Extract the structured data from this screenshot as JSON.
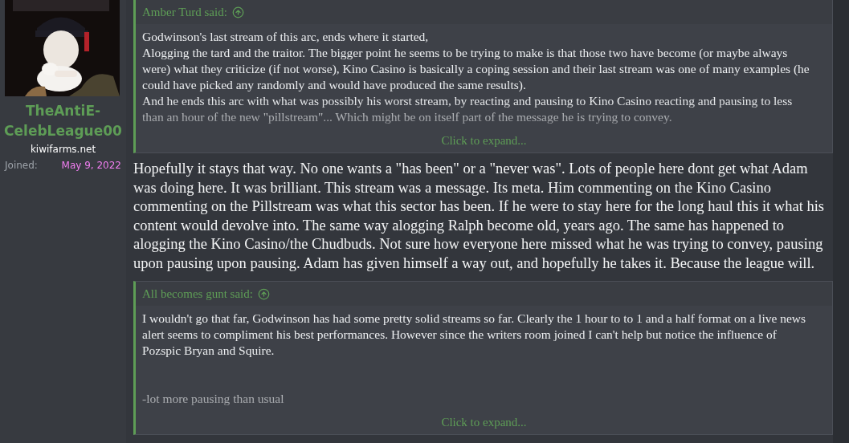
{
  "user": {
    "name": "TheAntiE-CelebLeague00",
    "title": "kiwifarms.net",
    "joined_label": "Joined:",
    "joined_date": "May 9, 2022"
  },
  "post": {
    "blocks": [
      {
        "kind": "quote",
        "author": "Amber Turd said:",
        "paragraphs": [
          "Godwinson's last stream of this arc, ends where it started,",
          "Alogging the tard and the traitor. The bigger point he seems to be trying to make is that those two have become (or maybe always were) what they criticize (if not worse), Kino Casino is basically a coping session and their last stream was one of many examples (he could have picked any randomly and would have produced the same results).",
          "And he ends this arc with what was possibly his worst stream, by reacting and pausing to Kino Casino reacting and pausing to less than an hour of the new \"pillstream\"... Which might be on itself part of the message he is trying to convey."
        ],
        "expand": "Click to expand...",
        "cut_top": true
      },
      {
        "kind": "text",
        "text": "Hopefully it stays that way. No one wants a \"has been\" or a \"never was\". Lots of people here dont get what Adam was doing here. It was brilliant. This stream was a message. Its meta. Him commenting on the Kino Casino commenting on the Pillstream was what this sector has been. If he were to stay here for the long haul this it what his content would devolve into. The same way alogging Ralph become old, years ago. The same has happened to alogging the Kino Casino/the Chudbuds. Not sure how everyone here missed what he was trying to convey, pausing upon pausing upon pausing. Adam has given himself a way out, and hopefully he takes it. Because the league will."
      },
      {
        "kind": "quote",
        "author": "All becomes gunt said:",
        "paragraphs": [
          "I wouldn't go that far, Godwinson has had some pretty solid streams so far. Clearly the 1 hour to to 1 and a half format on a live news alert seems to compliment his best performances. However since the writers room joined I can't help but notice the influence of Pozspic Bryan and Squire.",
          "-lot more pausing than usual"
        ],
        "expand": "Click to expand...",
        "cut_top": false
      }
    ]
  }
}
